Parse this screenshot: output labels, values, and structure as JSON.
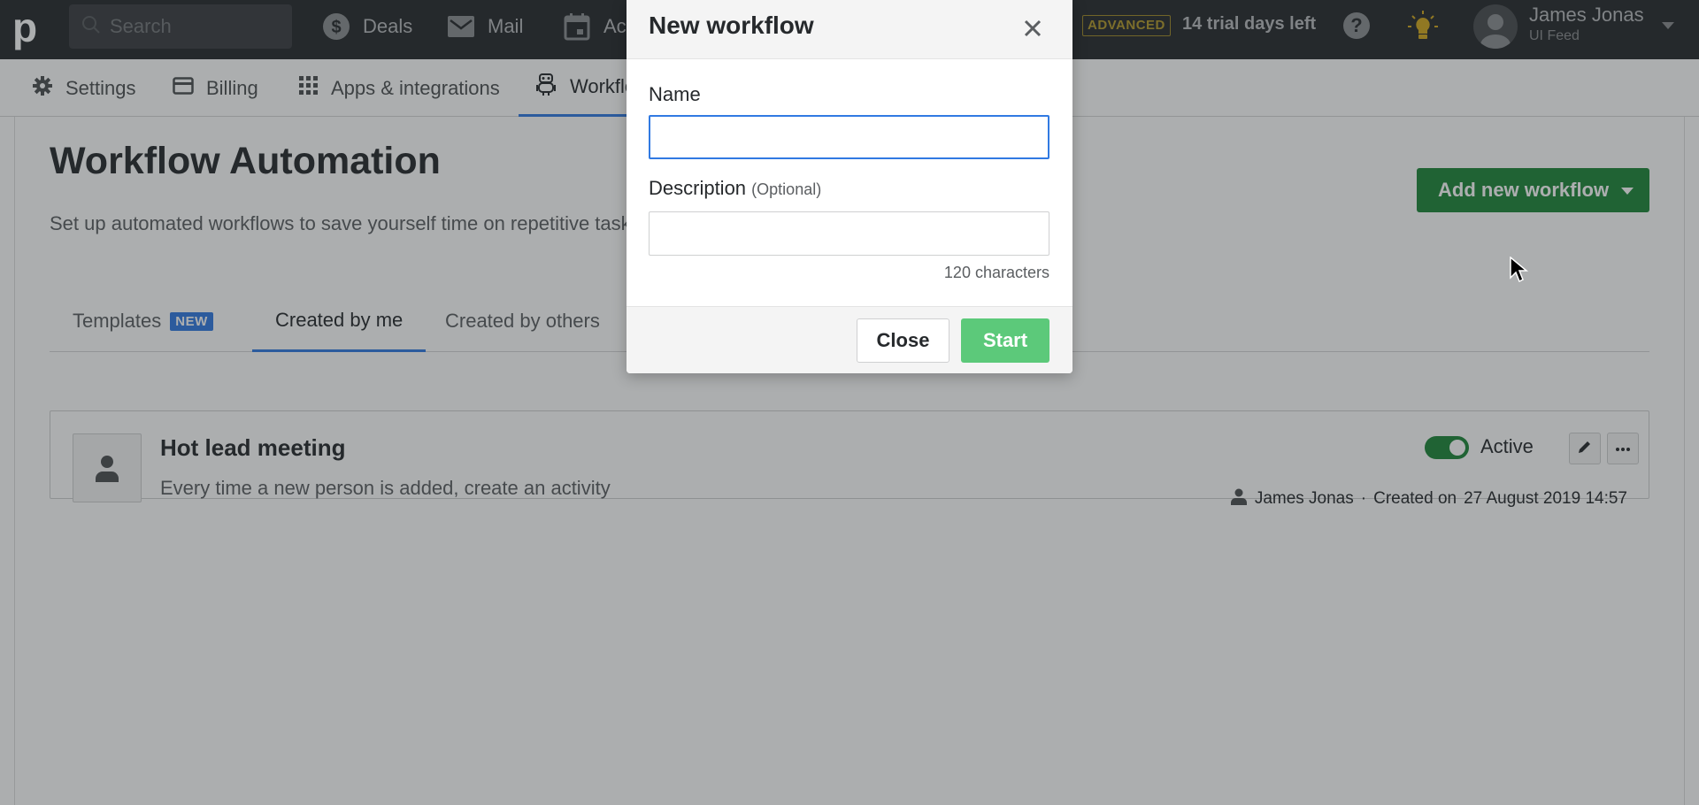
{
  "topbar": {
    "logo": "p",
    "search_placeholder": "Search",
    "nav": [
      {
        "label": "Deals",
        "icon": "dollar-icon"
      },
      {
        "label": "Mail",
        "icon": "mail-icon"
      },
      {
        "label": "Activities",
        "icon": "calendar-icon"
      }
    ],
    "plan_badge": "ADVANCED",
    "trial_text": "14 trial days left",
    "help_glyph": "?",
    "user": {
      "name": "James Jonas",
      "company": "UI Feed"
    }
  },
  "subnav": {
    "items": [
      {
        "label": "Settings",
        "icon": "gear-icon"
      },
      {
        "label": "Billing",
        "icon": "credit-card-icon"
      },
      {
        "label": "Apps & integrations",
        "icon": "grid-icon"
      },
      {
        "label": "Workflow automation",
        "icon": "robot-icon",
        "active": true
      }
    ]
  },
  "page": {
    "title": "Workflow Automation",
    "description": "Set up automated workflows to save yourself time on repetitive tasks and focus on what matters most.",
    "add_button": "Add new workflow",
    "tabs": [
      {
        "label": "Templates",
        "badge": "NEW"
      },
      {
        "label": "Created by me",
        "active": true
      },
      {
        "label": "Created by others"
      }
    ]
  },
  "workflows": [
    {
      "title": "Hot lead meeting",
      "description": "Every time a new person is added, create an activity",
      "status_label": "Active",
      "active": true,
      "owner": "James Jonas",
      "separator": "·",
      "created_label": "Created on",
      "created_date": "27 August 2019 14:57"
    }
  ],
  "modal": {
    "title": "New workflow",
    "name_label": "Name",
    "name_value": "",
    "description_label": "Description",
    "description_optional": "(Optional)",
    "description_value": "",
    "char_count": "120 characters",
    "close_button": "Close",
    "start_button": "Start"
  },
  "colors": {
    "topbar_bg": "#26292c",
    "primary_green": "#1d8739",
    "start_disabled_green": "#5cc97a",
    "accent_blue": "#317ae2",
    "advanced_gold": "#b49a2a"
  }
}
